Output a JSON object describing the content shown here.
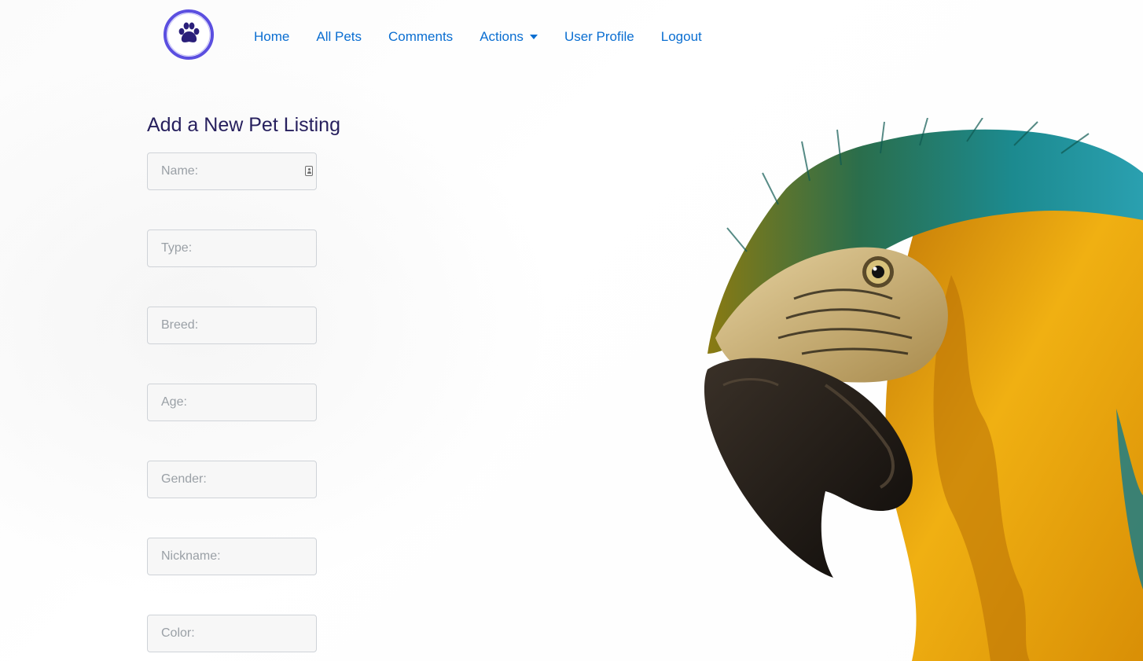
{
  "nav": {
    "logo_icon": "paw-print-icon",
    "links": [
      {
        "label": "Home"
      },
      {
        "label": "All Pets"
      },
      {
        "label": "Comments"
      },
      {
        "label": "Actions"
      },
      {
        "label": "User Profile"
      },
      {
        "label": "Logout"
      }
    ],
    "link_color": "#0a6ed1",
    "logo_ring_color": "#5b4fe0",
    "logo_paw_color": "#2a1f7a"
  },
  "form": {
    "title": "Add a New Pet Listing",
    "title_color": "#27205e",
    "fields": [
      {
        "placeholder": "Name:"
      },
      {
        "placeholder": "Type:"
      },
      {
        "placeholder": "Breed:"
      },
      {
        "placeholder": "Age:"
      },
      {
        "placeholder": "Gender:"
      },
      {
        "placeholder": "Nickname:"
      },
      {
        "placeholder": "Color:"
      }
    ]
  },
  "hero_image": {
    "subject": "macaw-parrot",
    "colors": {
      "feathers_gold": "#e8a20c",
      "feathers_teal": "#1c8a8f",
      "beak": "#1e1a16",
      "face": "#c9b48a"
    }
  }
}
